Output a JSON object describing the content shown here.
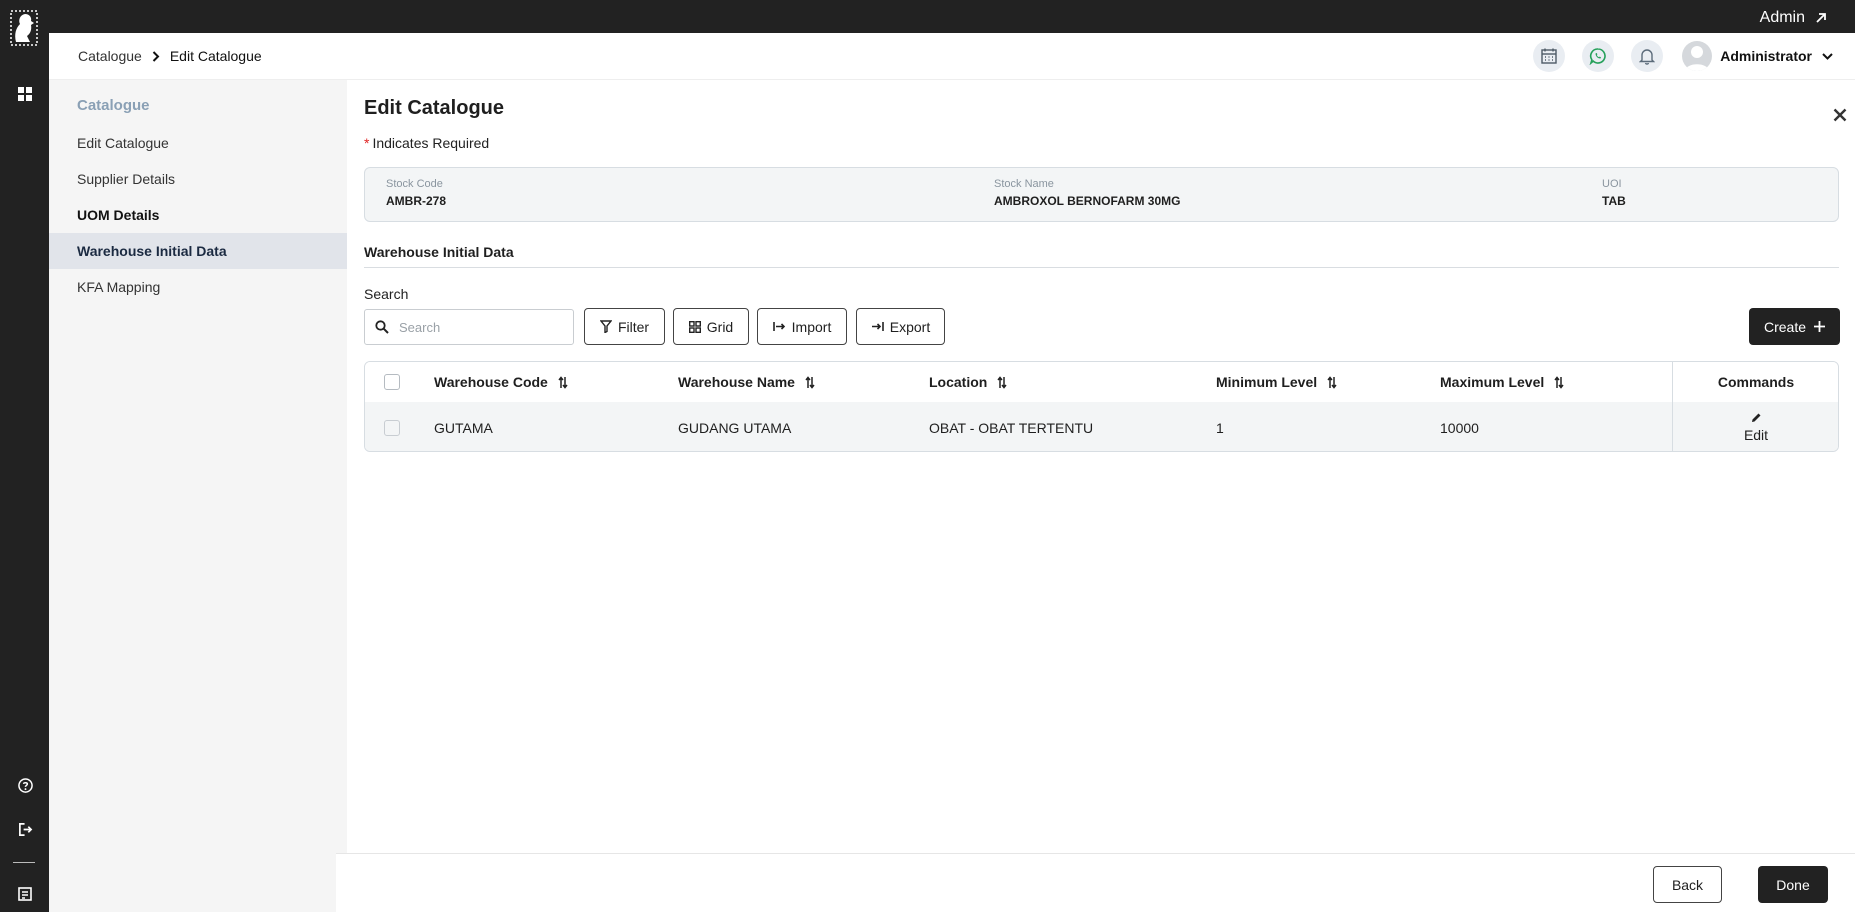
{
  "topbar": {
    "admin_link": "Admin"
  },
  "header": {
    "breadcrumb": {
      "root": "Catalogue",
      "current": "Edit Catalogue"
    },
    "user_name": "Administrator"
  },
  "sidenav": {
    "title": "Catalogue",
    "items": [
      {
        "label": "Edit Catalogue"
      },
      {
        "label": "Supplier Details"
      },
      {
        "label": "UOM Details"
      },
      {
        "label": "Warehouse Initial Data"
      },
      {
        "label": "KFA Mapping"
      }
    ]
  },
  "main": {
    "title": "Edit Catalogue",
    "required_star": "*",
    "required_note": "Indicates Required",
    "info": {
      "stock_code_label": "Stock Code",
      "stock_code": "AMBR-278",
      "stock_name_label": "Stock Name",
      "stock_name": "AMBROXOL BERNOFARM 30MG",
      "uoi_label": "UOI",
      "uoi": "TAB"
    },
    "section_title": "Warehouse Initial Data",
    "search_label": "Search",
    "search_placeholder": "Search",
    "toolbar": {
      "filter": "Filter",
      "grid": "Grid",
      "import": "Import",
      "export": "Export",
      "create": "Create"
    }
  },
  "table": {
    "columns": [
      "Warehouse Code",
      "Warehouse Name",
      "Location",
      "Minimum Level",
      "Maximum Level",
      "Commands"
    ],
    "rows": [
      {
        "warehouse_code": "GUTAMA",
        "warehouse_name": "GUDANG UTAMA",
        "location": "OBAT - OBAT TERTENTU",
        "minimum_level": "1",
        "maximum_level": "10000",
        "command": "Edit"
      }
    ]
  },
  "footer": {
    "back": "Back",
    "done": "Done"
  },
  "colors": {
    "dark": "#222222",
    "active_nav": "#e1e4ea",
    "sidebar": "#f5f5f5",
    "required": "#e02424",
    "whatsapp": "#25a05a"
  }
}
